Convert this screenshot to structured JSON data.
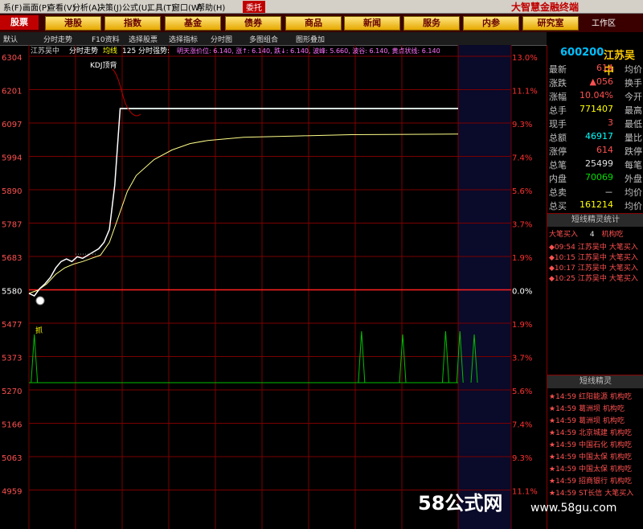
{
  "menu": [
    "系(F)",
    "画面(P)",
    "查看(V)",
    "分析(A)",
    "决策(J)",
    "公式(U)",
    "工具(T)",
    "窗口(W)",
    "帮助(H)"
  ],
  "menu_extra": "委托",
  "brand": "大智慧金融终端",
  "nav": {
    "stock_tab": "股票",
    "buttons": [
      "港股",
      "指数",
      "基金",
      "债券",
      "商品",
      "新闻",
      "服务",
      "内参",
      "研究室"
    ],
    "workspace": "工作区"
  },
  "toolbar": [
    "默认",
    "分时走势",
    "F10资料",
    "选择股票",
    "选择指标",
    "分时图",
    "多图组合",
    "图形叠加"
  ],
  "chart_header": {
    "name": "江苏吴中",
    "mode": "分时走势",
    "avg_label": "均线",
    "avg_value": "125",
    "label2": "分时强势:",
    "indicators": "明天涨价位: 6.140,  涨↑: 6.140,  跌↓: 6.140,  波峰: 5.660,  波谷: 6.140,  黄点状线: 6.140"
  },
  "annotation": "KDJ顶背",
  "grab_label": "抓",
  "chart_data": {
    "type": "line",
    "price_ticks": [
      "6304",
      "6201",
      "6097",
      "5994",
      "5890",
      "5787",
      "5683",
      "5580",
      "5477",
      "5373",
      "5270",
      "5166",
      "5063",
      "4959"
    ],
    "pct_ticks": [
      "13.0%",
      "11.1%",
      "9.3%",
      "7.4%",
      "5.6%",
      "3.7%",
      "1.9%",
      "0.0%",
      "1.9%",
      "3.7%",
      "5.6%",
      "7.4%",
      "9.3%",
      "11.1%"
    ],
    "prev_close": 5580,
    "price_series": [
      [
        0,
        5560
      ],
      [
        3,
        5552
      ],
      [
        6,
        5575
      ],
      [
        9,
        5590
      ],
      [
        12,
        5610
      ],
      [
        15,
        5640
      ],
      [
        18,
        5660
      ],
      [
        21,
        5668
      ],
      [
        24,
        5660
      ],
      [
        27,
        5675
      ],
      [
        30,
        5670
      ],
      [
        33,
        5680
      ],
      [
        36,
        5690
      ],
      [
        39,
        5700
      ],
      [
        42,
        5720
      ],
      [
        45,
        5760
      ],
      [
        48,
        5900
      ],
      [
        51,
        6140
      ],
      [
        55,
        6140
      ],
      [
        240,
        6140
      ]
    ],
    "avg_series": [
      [
        0,
        5560
      ],
      [
        5,
        5570
      ],
      [
        10,
        5590
      ],
      [
        15,
        5620
      ],
      [
        20,
        5640
      ],
      [
        25,
        5652
      ],
      [
        30,
        5660
      ],
      [
        35,
        5670
      ],
      [
        40,
        5680
      ],
      [
        45,
        5720
      ],
      [
        50,
        5800
      ],
      [
        55,
        5880
      ],
      [
        60,
        5930
      ],
      [
        70,
        5980
      ],
      [
        80,
        6010
      ],
      [
        90,
        6030
      ],
      [
        100,
        6040
      ],
      [
        120,
        6050
      ],
      [
        150,
        6054
      ],
      [
        180,
        6058
      ],
      [
        240,
        6060
      ]
    ],
    "volume_spikes": [
      [
        3,
        0.75
      ],
      [
        186,
        0.8
      ],
      [
        209,
        0.75
      ],
      [
        233,
        0.8
      ],
      [
        241,
        0.8
      ],
      [
        249,
        0.75
      ]
    ]
  },
  "quote": {
    "code": "600200",
    "name": "江苏吴中",
    "rows": [
      {
        "l": "最新",
        "v": "614",
        "c": "red",
        "r": "均价"
      },
      {
        "l": "涨跌",
        "v": "▲056",
        "c": "red",
        "r": "换手"
      },
      {
        "l": "涨幅",
        "v": "10.04%",
        "c": "red",
        "r": "今开"
      },
      {
        "l": "总手",
        "v": "771407",
        "c": "yellow",
        "r": "最高"
      },
      {
        "l": "现手",
        "v": "3",
        "c": "red",
        "r": "最低"
      },
      {
        "l": "总额",
        "v": "46917",
        "c": "cyan",
        "r": "量比"
      },
      {
        "l": "涨停",
        "v": "614",
        "c": "red",
        "r": "跌停"
      },
      {
        "l": "总笔",
        "v": "25499",
        "c": "white",
        "r": "每笔"
      },
      {
        "l": "内盘",
        "v": "70069",
        "c": "green",
        "r": "外盘"
      },
      {
        "l": "总卖",
        "v": "－",
        "c": "white",
        "r": "均价"
      },
      {
        "l": "总买",
        "v": "161214",
        "c": "yellow",
        "r": "均价"
      }
    ]
  },
  "signal_head": "短线精灵统计",
  "signal_head2": "短线精灵",
  "signal_stats": [
    "大笔买入",
    "4",
    "机构吃"
  ],
  "signals": [
    {
      "t": "◆09:54",
      "n": "江苏吴中",
      "e": "大笔买入"
    },
    {
      "t": "◆10:15",
      "n": "江苏吴中",
      "e": "大笔买入"
    },
    {
      "t": "◆10:17",
      "n": "江苏吴中",
      "e": "大笔买入"
    },
    {
      "t": "◆10:25",
      "n": "江苏吴中",
      "e": "大笔买入"
    }
  ],
  "signals2": [
    {
      "t": "★14:59",
      "n": "红阳能源",
      "e": "机构吃"
    },
    {
      "t": "★14:59",
      "n": "葛洲坝",
      "e": "机构吃"
    },
    {
      "t": "★14:59",
      "n": "葛洲坝",
      "e": "机构吃"
    },
    {
      "t": "★14:59",
      "n": "北京城建",
      "e": "机构吃"
    },
    {
      "t": "★14:59",
      "n": "中国石化",
      "e": "机构吃"
    },
    {
      "t": "★14:59",
      "n": "中国太保",
      "e": "机构吃"
    },
    {
      "t": "★14:59",
      "n": "中国太保",
      "e": "机构吃"
    },
    {
      "t": "★14:59",
      "n": "招商银行",
      "e": "机构吃"
    },
    {
      "t": "★14:59",
      "n": "ST长信",
      "e": "大笔买入"
    }
  ],
  "watermark": "58公式网",
  "watermark_url": "www.58gu.com",
  "colors": {
    "grid": "#7a0000",
    "price": "#ffffff",
    "avg": "#ffff88",
    "limit": "#a0ffd0",
    "vol": "#00c000",
    "pct": "#ff3030"
  }
}
